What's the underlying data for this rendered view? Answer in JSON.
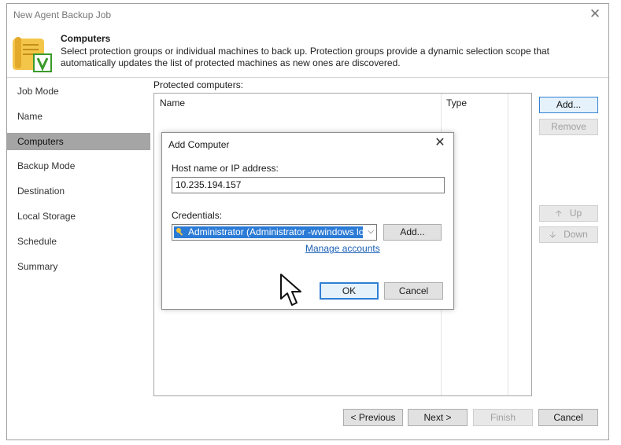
{
  "window": {
    "title": "New Agent Backup Job",
    "close_glyph": "✕"
  },
  "header": {
    "title": "Computers",
    "description": "Select protection groups or individual machines to back up. Protection groups provide a dynamic selection scope that automatically updates the list of protected machines as new ones are discovered.",
    "icon": "scroll-checkmark-icon"
  },
  "nav": {
    "items": [
      {
        "label": "Job Mode"
      },
      {
        "label": "Name"
      },
      {
        "label": "Computers"
      },
      {
        "label": "Backup Mode"
      },
      {
        "label": "Destination"
      },
      {
        "label": "Local Storage"
      },
      {
        "label": "Schedule"
      },
      {
        "label": "Summary"
      }
    ],
    "active": "Computers"
  },
  "main": {
    "protected_label": "Protected computers:",
    "columns": [
      "Name",
      "Type"
    ],
    "buttons": {
      "add": "Add...",
      "remove": "Remove",
      "up": "Up",
      "down": "Down"
    }
  },
  "dialog": {
    "title": "Add Computer",
    "close_glyph": "✕",
    "host_label": "Host name or IP address:",
    "host_value": "10.235.194.157",
    "credentials_label": "Credentials:",
    "credentials_value": "Administrator (Administrator -wwindows log",
    "add_label": "Add...",
    "manage_link": "Manage accounts",
    "ok_label": "OK",
    "cancel_label": "Cancel"
  },
  "footer": {
    "previous": "< Previous",
    "next": "Next >",
    "finish": "Finish",
    "cancel": "Cancel"
  },
  "colors": {
    "accent": "#2b7bd6",
    "nav_active": "#a5a5a5",
    "link": "#1a5fb4",
    "icon_green": "#3a9a2a",
    "icon_gold": "#e8b339"
  }
}
